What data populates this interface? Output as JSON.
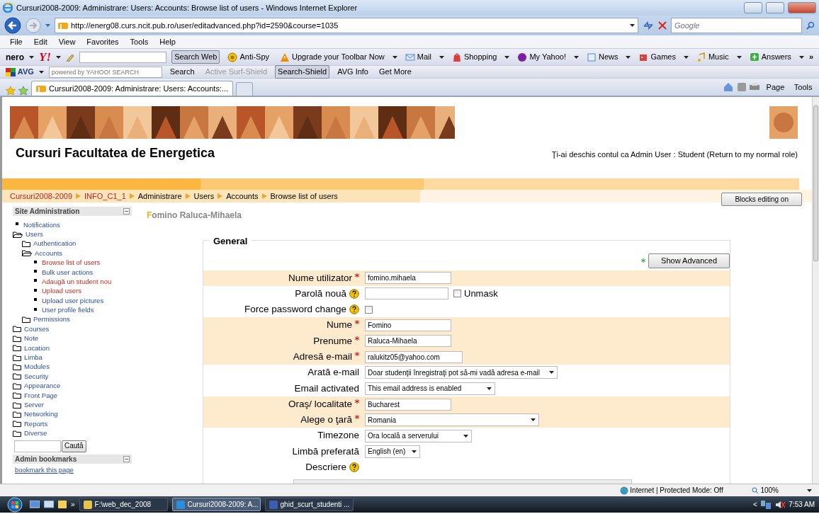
{
  "window": {
    "title": "Cursuri2008-2009: Administrare: Users: Accounts: Browse list of users - Windows Internet Explorer"
  },
  "address_bar": {
    "url": "http://energ08.curs.ncit.pub.ro/user/editadvanced.php?id=2590&course=1035",
    "search_placeholder": "Google"
  },
  "menu": [
    "File",
    "Edit",
    "View",
    "Favorites",
    "Tools",
    "Help"
  ],
  "yahoo_toolbar": {
    "logo": "nero",
    "yahoo_logo": "Y!",
    "search_button": "Search Web",
    "items": [
      {
        "label": "Anti-Spy"
      },
      {
        "label": "Upgrade your Toolbar Now"
      },
      {
        "label": "Mail"
      },
      {
        "label": "Shopping"
      },
      {
        "label": "My Yahoo!"
      },
      {
        "label": "News"
      },
      {
        "label": "Games"
      },
      {
        "label": "Music"
      },
      {
        "label": "Answers"
      }
    ],
    "more": "»"
  },
  "avg_toolbar": {
    "logo": "AVG",
    "search_placeholder": "powered by YAHOO! SEARCH",
    "items": [
      {
        "label": "Search",
        "disabled": false,
        "pressed": false
      },
      {
        "label": "Active  Surf-Shield",
        "disabled": true,
        "pressed": false
      },
      {
        "label": "Search-Shield",
        "disabled": false,
        "pressed": true
      },
      {
        "label": "AVG Info",
        "disabled": false,
        "pressed": false
      },
      {
        "label": "Get More",
        "disabled": false,
        "pressed": false
      }
    ]
  },
  "tabs": [
    {
      "label": "Cursuri2008-2009: Administrare: Users: Accounts:...",
      "selected": true
    }
  ],
  "command_bar": [
    "Page",
    "Tools"
  ],
  "page": {
    "site_title": "Cursuri Facultatea de Energetica",
    "login_info": {
      "prefix": "Ţi-ai deschis contul ca ",
      "user": "Admin User",
      "middle": " : Student (",
      "role_link": "Return to my normal role",
      "suffix": ")"
    },
    "breadcrumb": [
      {
        "label": "Cursuri2008-2009",
        "link": true
      },
      {
        "label": "INFO_C1_1",
        "link": true
      },
      {
        "label": "Administrare",
        "link": false
      },
      {
        "label": "Users",
        "link": false
      },
      {
        "label": "Accounts",
        "link": false
      },
      {
        "label": "Browse list of users",
        "link": false
      }
    ],
    "blocks_button": "Blocks editing on",
    "sidebar": {
      "title": "Site Administration",
      "tree": [
        {
          "label": "Notifications",
          "kind": "page",
          "visited": false
        },
        {
          "label": "Users",
          "kind": "folder",
          "expanded": true,
          "children": [
            {
              "label": "Authentication",
              "kind": "folder",
              "expanded": false
            },
            {
              "label": "Accounts",
              "kind": "folder",
              "expanded": true,
              "children": [
                {
                  "label": "Browse list of users",
                  "kind": "page",
                  "visited": true
                },
                {
                  "label": "Bulk user actions",
                  "kind": "page",
                  "visited": false
                },
                {
                  "label": "Adaugă un student nou",
                  "kind": "page",
                  "visited": true
                },
                {
                  "label": "Upload users",
                  "kind": "page",
                  "visited": true
                },
                {
                  "label": "Upload user pictures",
                  "kind": "page",
                  "visited": false
                },
                {
                  "label": "User profile fields",
                  "kind": "page",
                  "visited": false
                }
              ]
            },
            {
              "label": "Permissions",
              "kind": "folder",
              "expanded": false
            }
          ]
        },
        {
          "label": "Courses",
          "kind": "folder",
          "expanded": false
        },
        {
          "label": "Note",
          "kind": "folder",
          "expanded": false
        },
        {
          "label": "Location",
          "kind": "folder",
          "expanded": false
        },
        {
          "label": "Limba",
          "kind": "folder",
          "expanded": false
        },
        {
          "label": "Modules",
          "kind": "folder",
          "expanded": false
        },
        {
          "label": "Security",
          "kind": "folder",
          "expanded": false
        },
        {
          "label": "Appearance",
          "kind": "folder",
          "expanded": false
        },
        {
          "label": "Front Page",
          "kind": "folder",
          "expanded": false
        },
        {
          "label": "Server",
          "kind": "folder",
          "expanded": false
        },
        {
          "label": "Networking",
          "kind": "folder",
          "expanded": false
        },
        {
          "label": "Reports",
          "kind": "folder",
          "expanded": false
        },
        {
          "label": "Diverse",
          "kind": "folder",
          "expanded": false
        }
      ],
      "search_button": "Caută",
      "bookmarks_title": "Admin bookmarks",
      "bookmark_link": "bookmark this page"
    },
    "user_heading": "Fomino Raluca-Mihaela",
    "form": {
      "legend": "General",
      "advanced_button": "Show Advanced",
      "rows": [
        {
          "label": "Nume utilizator",
          "required": true,
          "help": false,
          "shaded": true,
          "kind": "text",
          "value": "fomino.mihaela"
        },
        {
          "label": "Parolă nouă",
          "required": false,
          "help": true,
          "shaded": false,
          "kind": "password",
          "unmask": {
            "label": "Unmask",
            "checked": false
          }
        },
        {
          "label": "Force password change",
          "required": false,
          "help": true,
          "shaded": false,
          "kind": "checkbox",
          "checked": false
        },
        {
          "label": "Nume",
          "required": true,
          "help": false,
          "shaded": true,
          "kind": "text",
          "value": "Fomino"
        },
        {
          "label": "Prenume",
          "required": true,
          "help": false,
          "shaded": true,
          "kind": "text",
          "value": "Raluca-Mihaela"
        },
        {
          "label": "Adresă e-mail",
          "required": true,
          "help": false,
          "shaded": true,
          "kind": "text",
          "value": "ralukitz05@yahoo.com"
        },
        {
          "label": "Arată e-mail",
          "required": false,
          "help": false,
          "shaded": false,
          "kind": "select",
          "value": "Doar studenţii înregistraţi pot să-mi vadă adresa e-mail"
        },
        {
          "label": "Email activated",
          "required": false,
          "help": false,
          "shaded": false,
          "kind": "select",
          "value": "This email address is enabled"
        },
        {
          "label": "Oraş/ localitate",
          "required": true,
          "help": false,
          "shaded": true,
          "kind": "text",
          "value": "Bucharest"
        },
        {
          "label": "Alege o ţară",
          "required": true,
          "help": false,
          "shaded": true,
          "kind": "select",
          "value": "Romania"
        },
        {
          "label": "Timezone",
          "required": false,
          "help": false,
          "shaded": false,
          "kind": "select",
          "value": "Ora locală a serverului"
        },
        {
          "label": "Limbă preferată",
          "required": false,
          "help": false,
          "shaded": false,
          "kind": "select",
          "value": "English (en)"
        },
        {
          "label": "Descriere",
          "required": false,
          "help": true,
          "shaded": false,
          "kind": "none"
        }
      ]
    }
  },
  "status_bar": {
    "zone": "Internet | Protected Mode: Off",
    "zoom": "100%"
  },
  "taskbar": {
    "more": "»",
    "tasks": [
      {
        "label": "F:\\web_dec_2008",
        "selected": false
      },
      {
        "label": "Cursuri2008-2009: A...",
        "selected": true
      },
      {
        "label": "ghid_scurt_studenti ...",
        "selected": false
      }
    ],
    "tray_arrow": "<",
    "clock": "7:53 AM"
  }
}
